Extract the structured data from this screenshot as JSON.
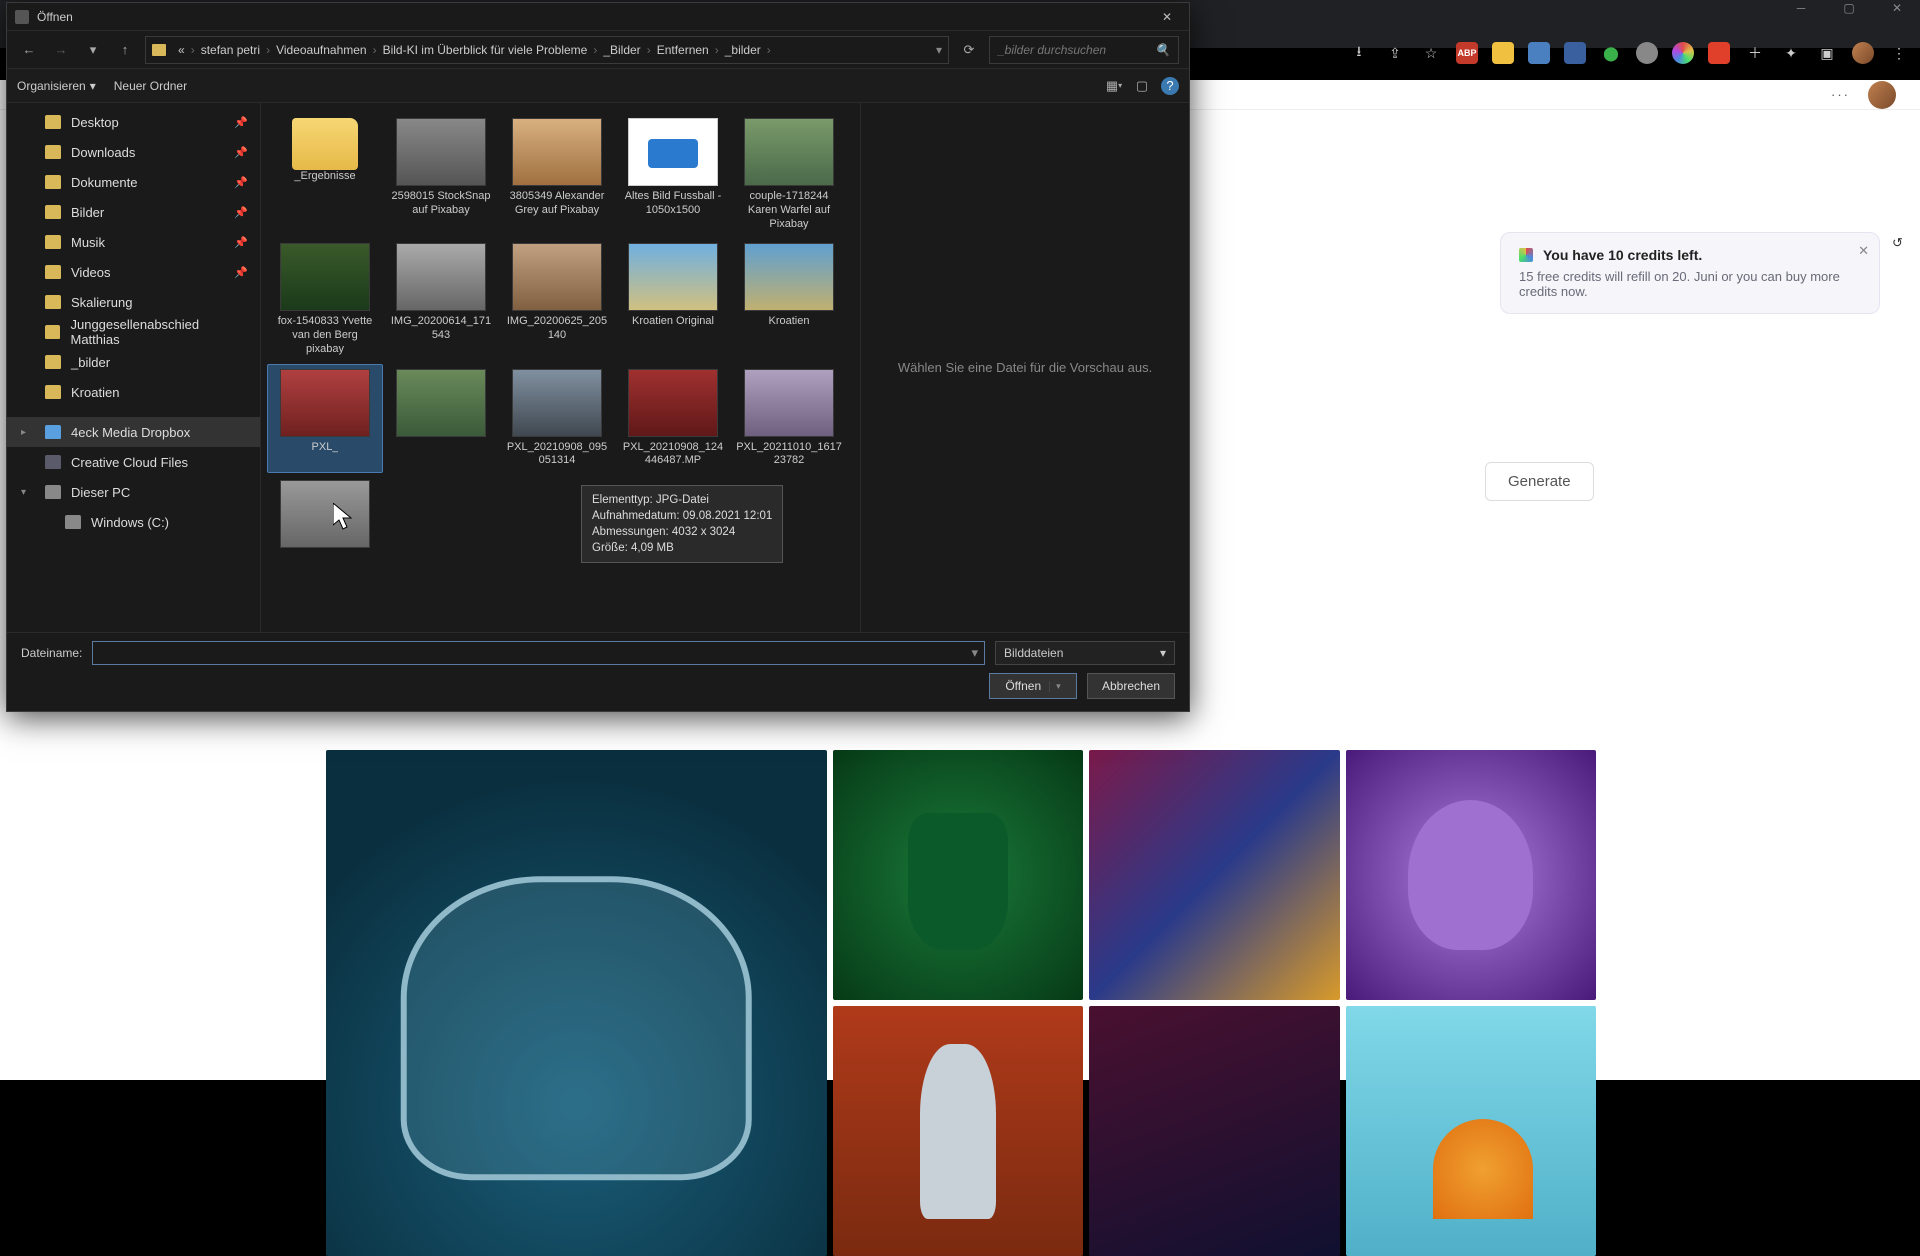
{
  "browser": {
    "window_controls": [
      "minimize",
      "maximize",
      "close"
    ],
    "ext_icons": [
      "download",
      "share",
      "star",
      "abp",
      "note",
      "window",
      "cube",
      "leaf",
      "circle",
      "colorwheel",
      "adobe",
      "plus",
      "puzzle",
      "panel",
      "avatar",
      "menu"
    ]
  },
  "page": {
    "more_label": "···",
    "credits": {
      "title": "You have 10 credits left.",
      "subtitle": "15 free credits will refill on 20. Juni or you can buy more credits now."
    },
    "generate_label": "Generate"
  },
  "dialog": {
    "title": "Öffnen",
    "breadcrumbs": [
      "«",
      "stefan petri",
      "Videoaufnahmen",
      "Bild-KI im Überblick für viele Probleme",
      "_Bilder",
      "Entfernen",
      "_bilder"
    ],
    "search_placeholder": "_bilder durchsuchen",
    "organize_label": "Organisieren",
    "new_folder_label": "Neuer Ordner",
    "preview_hint": "Wählen Sie eine Datei für die Vorschau aus.",
    "filename_label": "Dateiname:",
    "filename_value": "",
    "filetype_label": "Bilddateien",
    "open_label": "Öffnen",
    "cancel_label": "Abbrechen",
    "sidebar": {
      "quick": [
        {
          "label": "Desktop",
          "pinned": true
        },
        {
          "label": "Downloads",
          "pinned": true
        },
        {
          "label": "Dokumente",
          "pinned": true
        },
        {
          "label": "Bilder",
          "pinned": true
        },
        {
          "label": "Musik",
          "pinned": true
        },
        {
          "label": "Videos",
          "pinned": true
        },
        {
          "label": "Skalierung",
          "pinned": false
        },
        {
          "label": "Junggesellenabschied Matthias",
          "pinned": false
        },
        {
          "label": "_bilder",
          "pinned": false
        },
        {
          "label": "Kroatien",
          "pinned": false
        }
      ],
      "dropbox_label": "4eck Media Dropbox",
      "ccfiles_label": "Creative Cloud Files",
      "thispc_label": "Dieser PC",
      "drive_label": "Windows (C:)"
    },
    "files": [
      {
        "label": "_Ergebnisse",
        "kind": "folder"
      },
      {
        "label": "2598015 StockSnap auf Pixabay",
        "kind": "image",
        "thumb": "t-street"
      },
      {
        "label": "3805349 Alexander Grey auf Pixabay",
        "kind": "image",
        "thumb": "t-blonde"
      },
      {
        "label": "Altes Bild Fussball - 1050x1500",
        "kind": "doc",
        "thumb": "t-docicon"
      },
      {
        "label": "couple-1718244 Karen Warfel auf Pixabay",
        "kind": "image",
        "thumb": "t-bike"
      },
      {
        "label": "fox-1540833 Yvette van den Berg pixabay",
        "kind": "image",
        "thumb": "t-fox"
      },
      {
        "label": "IMG_20200614_171543",
        "kind": "image",
        "thumb": "t-sport"
      },
      {
        "label": "IMG_20200625_205140",
        "kind": "image",
        "thumb": "t-run"
      },
      {
        "label": "Kroatien Original",
        "kind": "image",
        "thumb": "t-beach"
      },
      {
        "label": "Kroatien",
        "kind": "image",
        "thumb": "t-beach2"
      },
      {
        "label": "PXL_",
        "kind": "image",
        "thumb": "t-red",
        "hovered": true
      },
      {
        "label": "",
        "kind": "image",
        "thumb": "t-path"
      },
      {
        "label": "PXL_20210908_095051314",
        "kind": "image",
        "thumb": "t-bridge"
      },
      {
        "label": "PXL_20210908_124446487.MP",
        "kind": "image",
        "thumb": "t-red2"
      },
      {
        "label": "PXL_20211010_161723782",
        "kind": "image",
        "thumb": "t-house"
      },
      {
        "label": "",
        "kind": "image",
        "thumb": "t-grey"
      }
    ],
    "tooltip": {
      "line1": "Elementtyp: JPG-Datei",
      "line2": "Aufnahmedatum: 09.08.2021 12:01",
      "line3": "Abmessungen: 4032 x 3024",
      "line4": "Größe: 4,09 MB"
    }
  }
}
